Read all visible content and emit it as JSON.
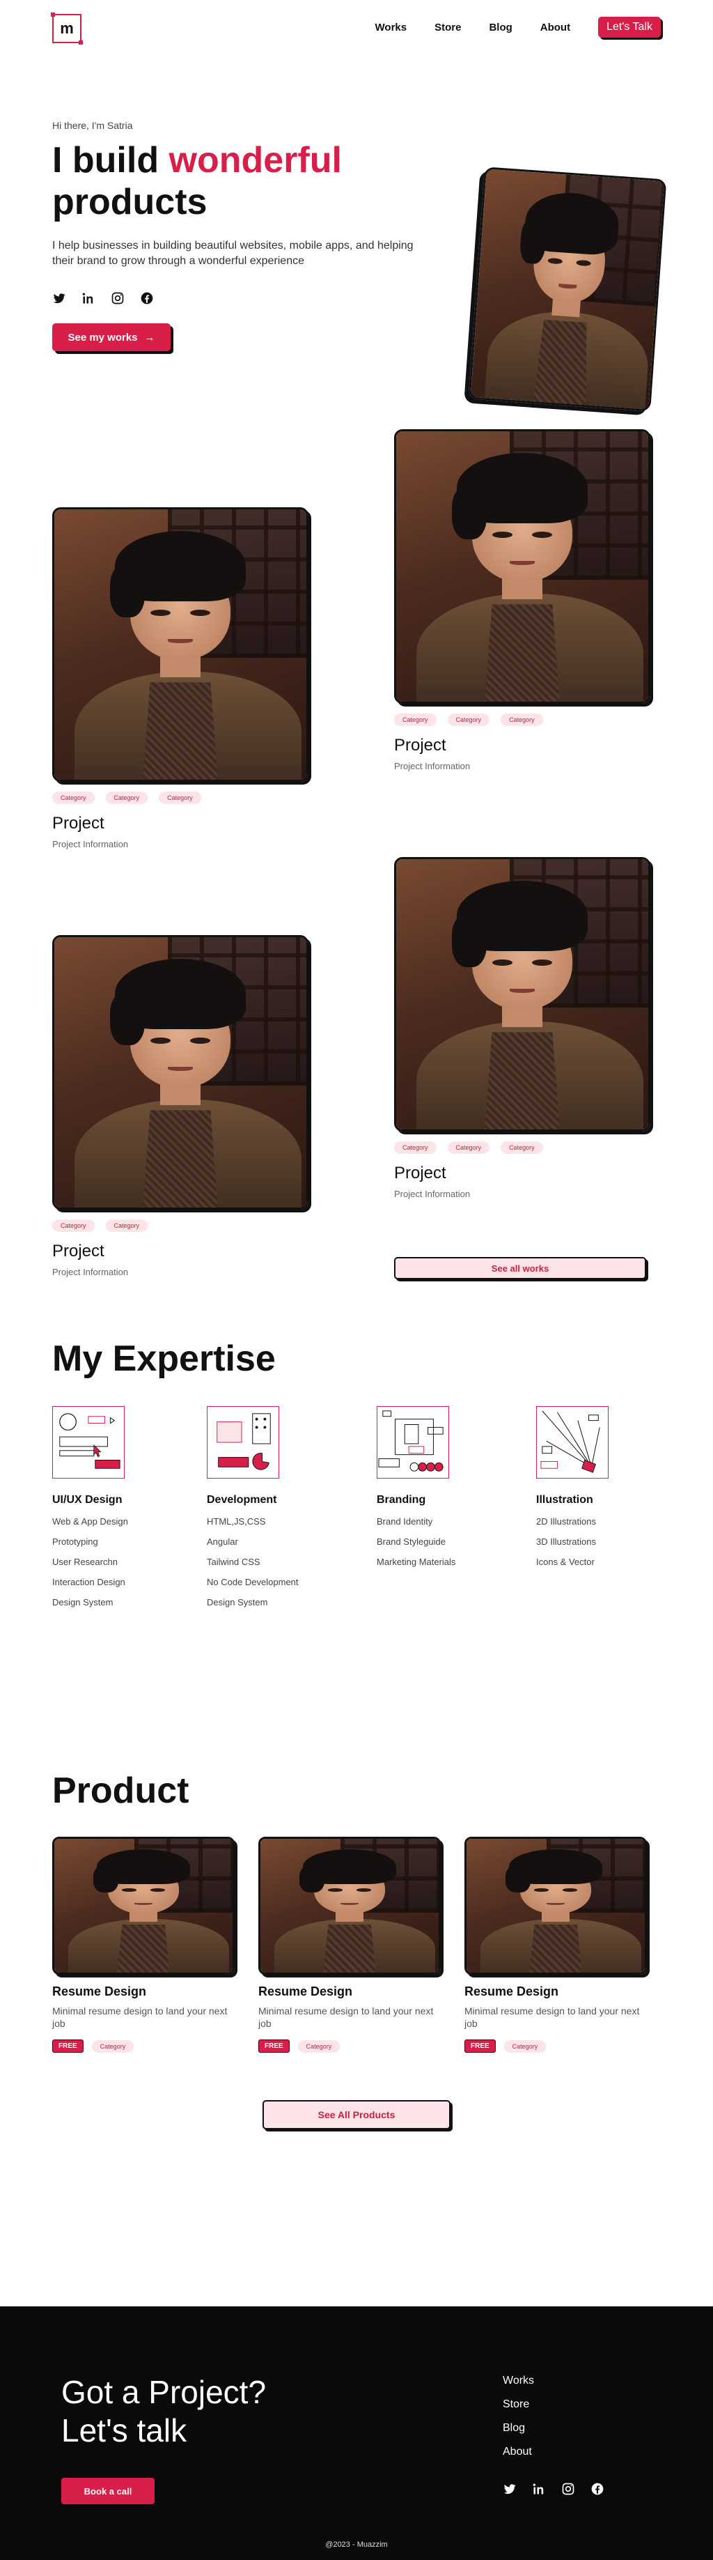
{
  "nav": {
    "logo": "m",
    "links": [
      "Works",
      "Store",
      "Blog",
      "About"
    ],
    "cta": "Let's Talk"
  },
  "hero": {
    "greeting": "Hi there, I'm Satria",
    "title_part1": "I build ",
    "title_accent": "wonderful",
    "title_part2": "products",
    "description": "I help businesses in building beautiful websites, mobile apps, and helping their brand to grow through a wonderful experience",
    "socials": [
      "twitter-icon",
      "linkedin-icon",
      "instagram-icon",
      "facebook-icon"
    ],
    "button": "See my works",
    "accent_color": "#d81f4a"
  },
  "works": {
    "projects": [
      {
        "title": "Project",
        "info": "Project Information",
        "tags": [
          "Category",
          "Category",
          "Category"
        ]
      },
      {
        "title": "Project",
        "info": "Project Information",
        "tags": [
          "Category",
          "Category",
          "Category"
        ]
      },
      {
        "title": "Project",
        "info": "Project Information",
        "tags": [
          "Category",
          "Category",
          "Category"
        ]
      },
      {
        "title": "Project",
        "info": "Project Information",
        "tags": [
          "Category",
          "Category"
        ]
      }
    ],
    "see_all": "See all works"
  },
  "expertise": {
    "title": "My Expertise",
    "columns": [
      {
        "name": "UI/UX Design",
        "items": [
          "Web & App Design",
          "Prototyping",
          "User Researchn",
          "Interaction Design",
          "Design System"
        ]
      },
      {
        "name": "Development",
        "items": [
          "HTML,JS,CSS",
          "Angular",
          "Tailwind CSS",
          "No Code Development",
          "Design System"
        ]
      },
      {
        "name": "Branding",
        "items": [
          "Brand Identity",
          "Brand Styleguide",
          "Marketing Materials"
        ]
      },
      {
        "name": "Illustration",
        "items": [
          "2D Illustrations",
          "3D Illustrations",
          "Icons & Vector"
        ]
      }
    ]
  },
  "products": {
    "title": "Product",
    "items": [
      {
        "title": "Resume Design",
        "desc": "Minimal resume design to land your next job",
        "badge": "FREE",
        "category": "Category"
      },
      {
        "title": "Resume Design",
        "desc": "Minimal resume design to land your next job",
        "badge": "FREE",
        "category": "Category"
      },
      {
        "title": "Resume Design",
        "desc": "Minimal resume design to land your next job",
        "badge": "FREE",
        "category": "Category"
      }
    ],
    "see_all": "See All Products"
  },
  "footer": {
    "heading_line1": "Got a Project?",
    "heading_line2": "Let's talk",
    "button": "Book a call",
    "links": [
      "Works",
      "Store",
      "Blog",
      "About"
    ],
    "socials": [
      "twitter-icon",
      "linkedin-icon",
      "instagram-icon",
      "facebook-icon"
    ],
    "copyright": "@2023 - Muazzim"
  }
}
